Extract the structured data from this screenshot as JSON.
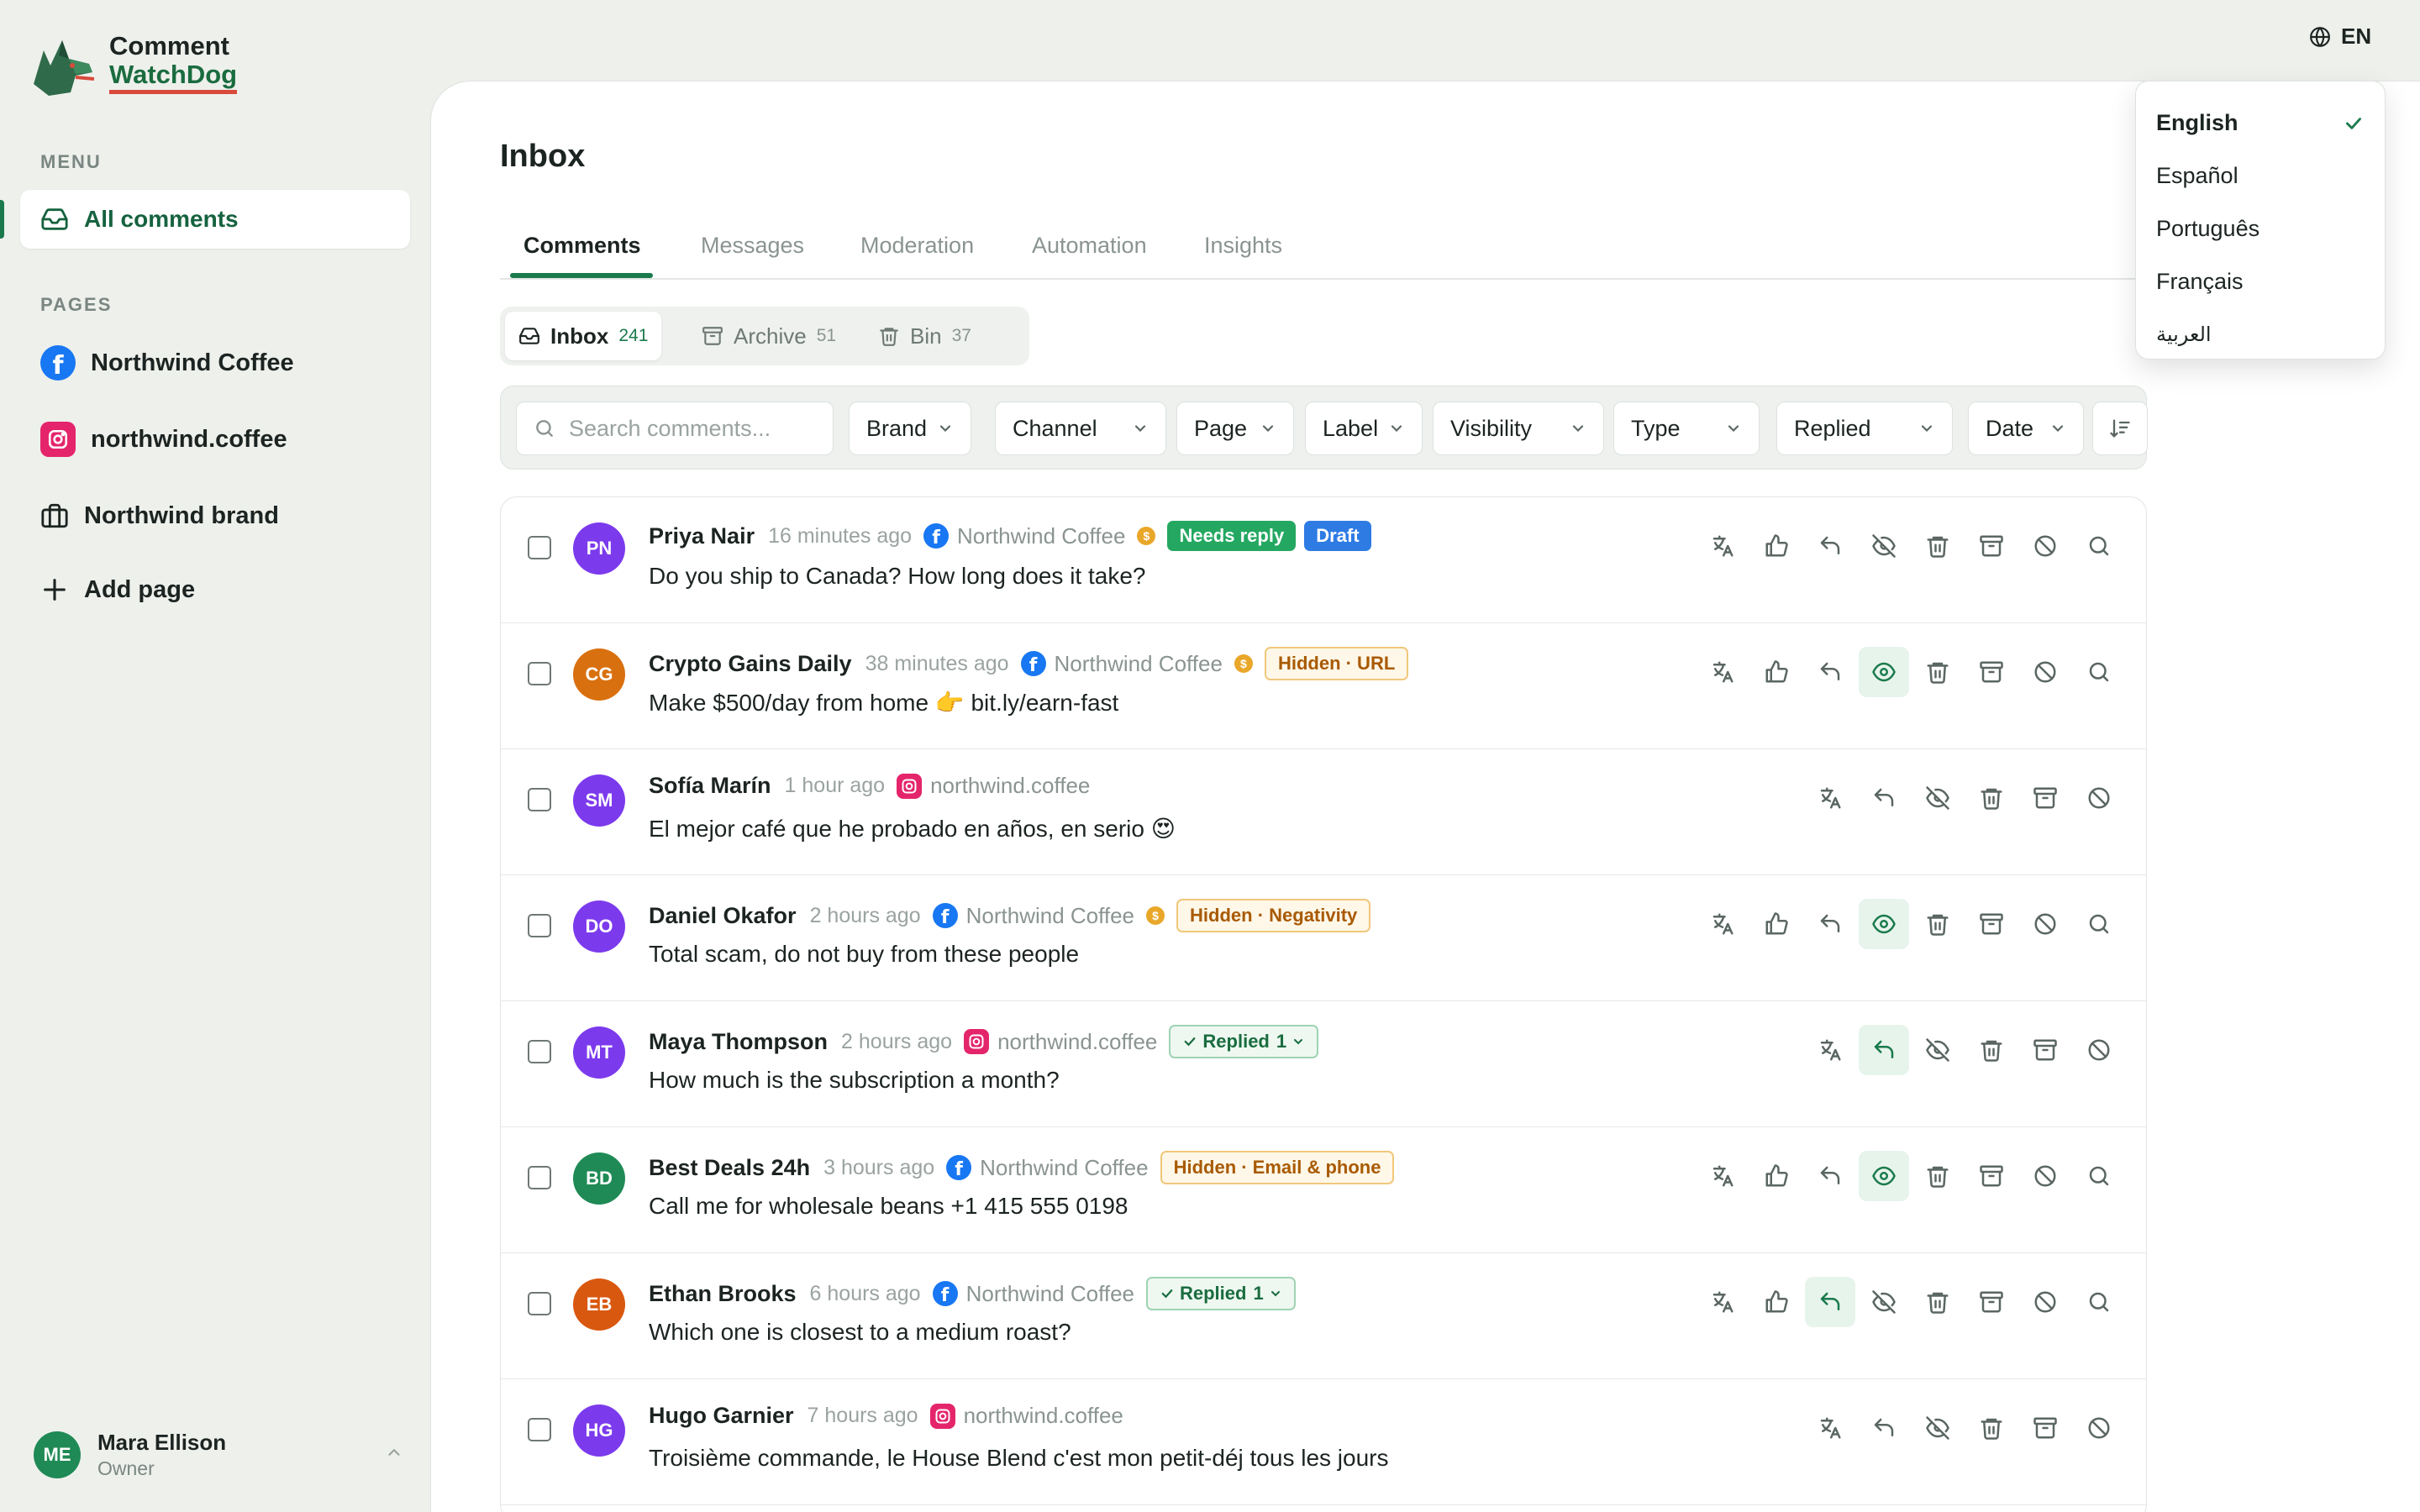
{
  "app": {
    "title_line1": "Comment",
    "title_line2": "WatchDog",
    "language_code": "EN"
  },
  "sidebar": {
    "menu_label": "MENU",
    "menu_items": [
      {
        "label": "All comments",
        "icon": "inbox-icon"
      }
    ],
    "pages_label": "PAGES",
    "pages": [
      {
        "label": "Northwind Coffee",
        "icon": "facebook-icon"
      },
      {
        "label": "northwind.coffee",
        "icon": "instagram-icon"
      },
      {
        "label": "Northwind brand",
        "icon": "briefcase-icon"
      }
    ],
    "add_page_label": "Add page",
    "user": {
      "initials": "ME",
      "name": "Mara Ellison",
      "role": "Owner"
    }
  },
  "language_menu": {
    "options": [
      "English",
      "Español",
      "Português",
      "Français",
      "العربية"
    ],
    "selected": "English"
  },
  "main": {
    "title": "Inbox",
    "tabs": [
      "Comments",
      "Messages",
      "Moderation",
      "Automation",
      "Insights"
    ],
    "active_tab": "Comments",
    "segments": [
      {
        "label": "Inbox",
        "count": "241"
      },
      {
        "label": "Archive",
        "count": "51"
      },
      {
        "label": "Bin",
        "count": "37"
      }
    ],
    "search_placeholder": "Search comments...",
    "filters": [
      "Brand",
      "Channel",
      "Page",
      "Label",
      "Visibility",
      "Type",
      "Replied",
      "Date"
    ]
  },
  "comments": [
    {
      "initials": "PN",
      "author": "Priya Nair",
      "time": "16 minutes ago",
      "source": "Northwind Coffee",
      "text": "Do you ship to Canada? How long does it take?",
      "badges": [
        "Needs reply",
        "Draft"
      ]
    },
    {
      "initials": "CG",
      "author": "Crypto Gains Daily",
      "time": "38 minutes ago",
      "source": "Northwind Coffee",
      "text": "Make $500/day from home 👉 bit.ly/earn-fast",
      "badges": [
        "Hidden · URL"
      ]
    },
    {
      "initials": "SM",
      "author": "Sofía Marín",
      "time": "1 hour ago",
      "source": "northwind.coffee",
      "text": "El mejor café que he probado en años, en serio 😍",
      "badges": []
    },
    {
      "initials": "DO",
      "author": "Daniel Okafor",
      "time": "2 hours ago",
      "source": "Northwind Coffee",
      "text": "Total scam, do not buy from these people",
      "badges": [
        "Hidden · Negativity"
      ]
    },
    {
      "initials": "MT",
      "author": "Maya Thompson",
      "time": "2 hours ago",
      "source": "northwind.coffee",
      "text": "How much is the subscription a month?",
      "badges": [
        "Replied",
        "1"
      ]
    },
    {
      "initials": "BD",
      "author": "Best Deals 24h",
      "time": "3 hours ago",
      "source": "Northwind Coffee",
      "text": "Call me for wholesale beans +1 415 555 0198",
      "badges": [
        "Hidden · Email & phone"
      ]
    },
    {
      "initials": "EB",
      "author": "Ethan Brooks",
      "time": "6 hours ago",
      "source": "Northwind Coffee",
      "text": "Which one is closest to a medium roast?",
      "badges": [
        "Replied",
        "1"
      ]
    },
    {
      "initials": "HG",
      "author": "Hugo Garnier",
      "time": "7 hours ago",
      "source": "northwind.coffee",
      "text": "Troisième commande, le House Blend c'est mon petit-déj tous les jours",
      "badges": []
    }
  ],
  "colors": {
    "accent": "#1a7a4c",
    "background": "#eef0ec",
    "needs_reply": "#24a861",
    "draft": "#2e7be4",
    "hidden_text": "#a85a00",
    "avatar_purple": "#7c3aed",
    "avatar_orange": "#d9700f",
    "avatar_green": "#1f8a55"
  }
}
